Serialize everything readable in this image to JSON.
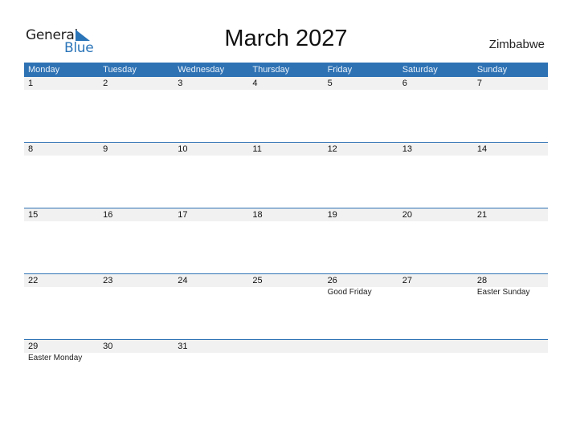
{
  "logo": {
    "line1": "General",
    "line2": "Blue",
    "accent": "#2a74b8"
  },
  "header": {
    "title": "March 2027",
    "country": "Zimbabwe"
  },
  "calendar": {
    "weekdays": [
      "Monday",
      "Tuesday",
      "Wednesday",
      "Thursday",
      "Friday",
      "Saturday",
      "Sunday"
    ],
    "weeks": [
      [
        {
          "day": "1",
          "holiday": ""
        },
        {
          "day": "2",
          "holiday": ""
        },
        {
          "day": "3",
          "holiday": ""
        },
        {
          "day": "4",
          "holiday": ""
        },
        {
          "day": "5",
          "holiday": ""
        },
        {
          "day": "6",
          "holiday": ""
        },
        {
          "day": "7",
          "holiday": ""
        }
      ],
      [
        {
          "day": "8",
          "holiday": ""
        },
        {
          "day": "9",
          "holiday": ""
        },
        {
          "day": "10",
          "holiday": ""
        },
        {
          "day": "11",
          "holiday": ""
        },
        {
          "day": "12",
          "holiday": ""
        },
        {
          "day": "13",
          "holiday": ""
        },
        {
          "day": "14",
          "holiday": ""
        }
      ],
      [
        {
          "day": "15",
          "holiday": ""
        },
        {
          "day": "16",
          "holiday": ""
        },
        {
          "day": "17",
          "holiday": ""
        },
        {
          "day": "18",
          "holiday": ""
        },
        {
          "day": "19",
          "holiday": ""
        },
        {
          "day": "20",
          "holiday": ""
        },
        {
          "day": "21",
          "holiday": ""
        }
      ],
      [
        {
          "day": "22",
          "holiday": ""
        },
        {
          "day": "23",
          "holiday": ""
        },
        {
          "day": "24",
          "holiday": ""
        },
        {
          "day": "25",
          "holiday": ""
        },
        {
          "day": "26",
          "holiday": "Good Friday"
        },
        {
          "day": "27",
          "holiday": ""
        },
        {
          "day": "28",
          "holiday": "Easter Sunday"
        }
      ],
      [
        {
          "day": "29",
          "holiday": "Easter Monday"
        },
        {
          "day": "30",
          "holiday": ""
        },
        {
          "day": "31",
          "holiday": ""
        },
        {
          "day": "",
          "holiday": ""
        },
        {
          "day": "",
          "holiday": ""
        },
        {
          "day": "",
          "holiday": ""
        },
        {
          "day": "",
          "holiday": ""
        }
      ]
    ]
  }
}
